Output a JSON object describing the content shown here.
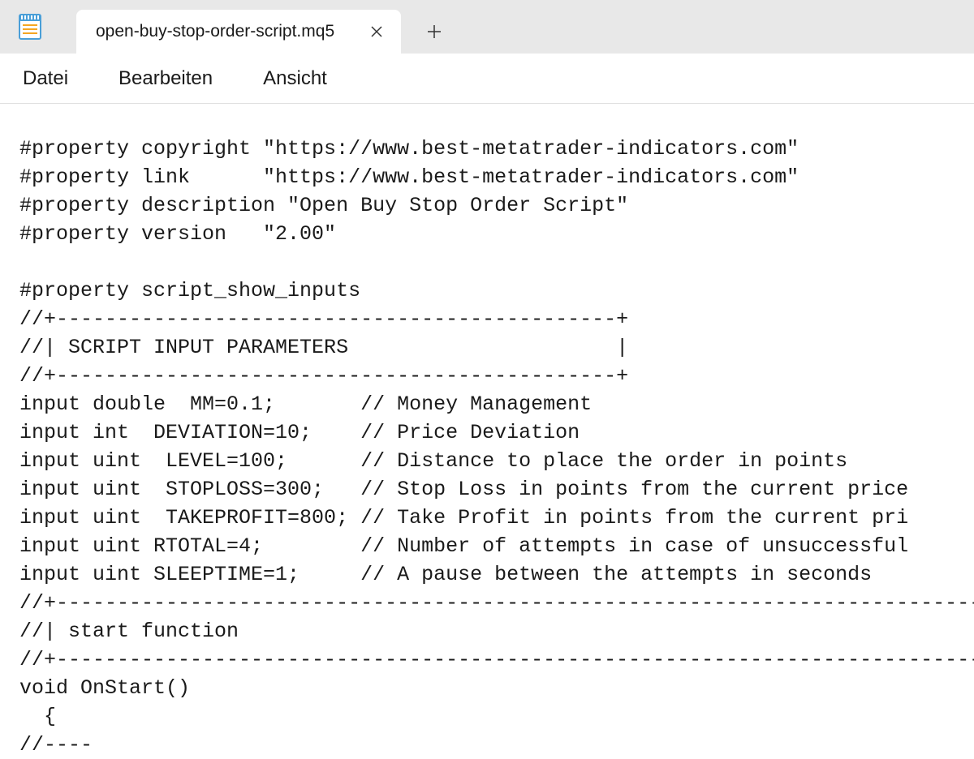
{
  "titlebar": {
    "tab_name": "open-buy-stop-order-script.mq5"
  },
  "menu": {
    "file": "Datei",
    "edit": "Bearbeiten",
    "view": "Ansicht"
  },
  "code_lines": [
    "#property copyright \"https://www.best-metatrader-indicators.com\"",
    "#property link      \"https://www.best-metatrader-indicators.com\"",
    "#property description \"Open Buy Stop Order Script\"",
    "#property version   \"2.00\"",
    "",
    "#property script_show_inputs",
    "//+----------------------------------------------+",
    "//| SCRIPT INPUT PARAMETERS                      |",
    "//+----------------------------------------------+",
    "input double  MM=0.1;       // Money Management",
    "input int  DEVIATION=10;    // Price Deviation",
    "input uint  LEVEL=100;      // Distance to place the order in points",
    "input uint  STOPLOSS=300;   // Stop Loss in points from the current price",
    "input uint  TAKEPROFIT=800; // Take Profit in points from the current pri",
    "input uint RTOTAL=4;        // Number of attempts in case of unsuccessful",
    "input uint SLEEPTIME=1;     // A pause between the attempts in seconds",
    "//+-------------------------------------------------------------------------------+",
    "//| start function                                                                |",
    "//+-------------------------------------------------------------------------------+",
    "void OnStart()",
    "  {",
    "//----"
  ]
}
